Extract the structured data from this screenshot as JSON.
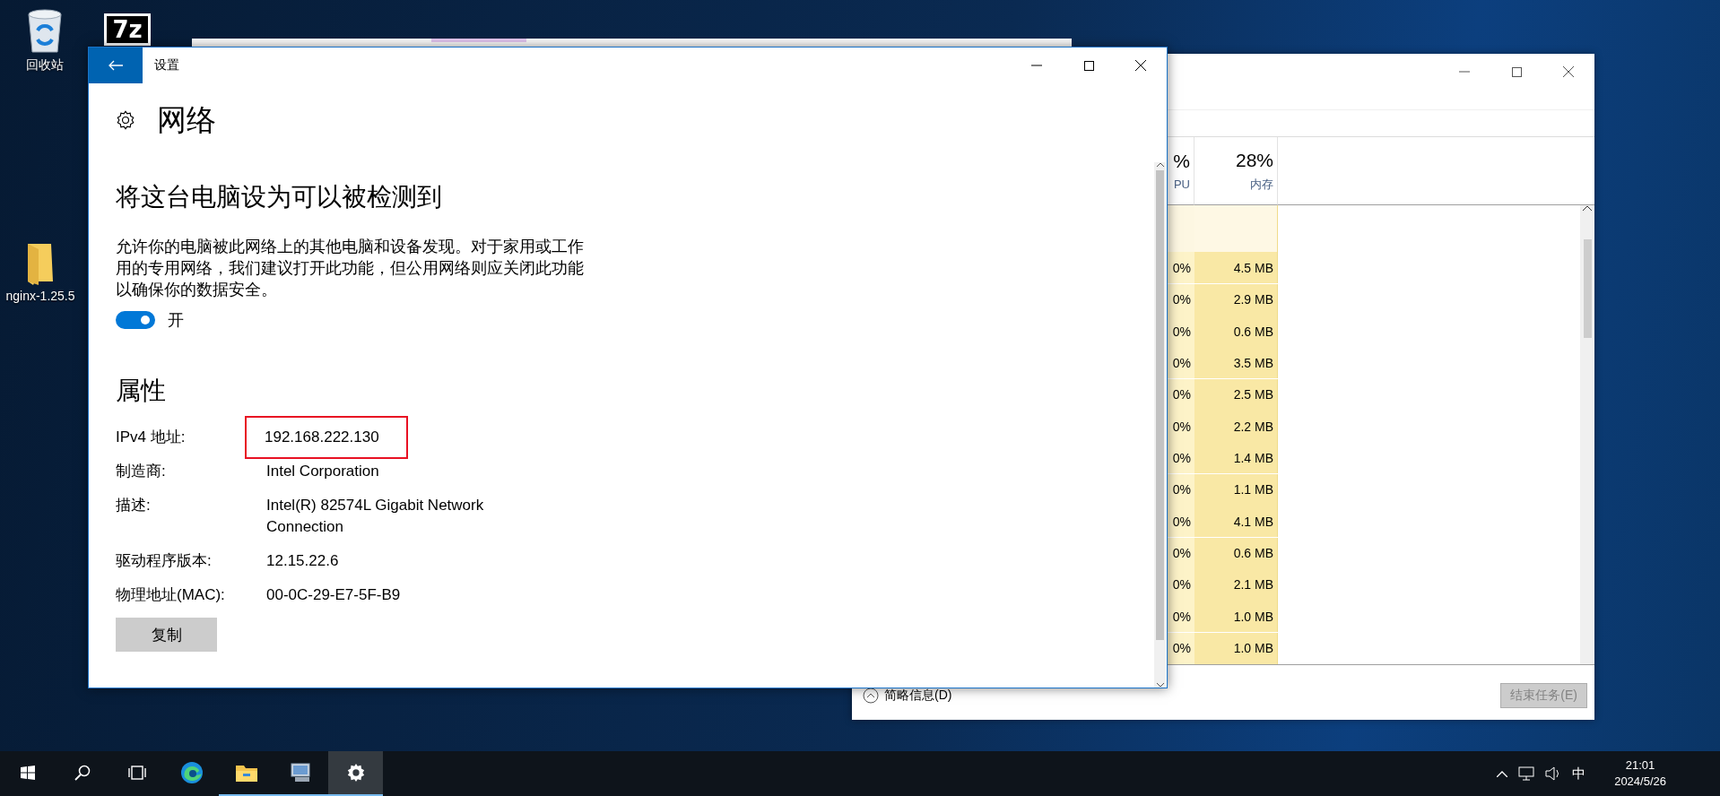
{
  "desktop": {
    "icons": [
      {
        "kind": "recycle-bin",
        "label": "回收站"
      },
      {
        "kind": "archive",
        "badge": "7z"
      },
      {
        "kind": "folder",
        "label": "nginx-1.25.5"
      }
    ]
  },
  "task_manager": {
    "columns": [
      {
        "value": "%",
        "label": "PU"
      },
      {
        "value": "28%",
        "label": "内存"
      }
    ],
    "rows": [
      {
        "cpu": "0%",
        "memory": "4.5 MB"
      },
      {
        "cpu": "0%",
        "memory": "2.9 MB"
      },
      {
        "cpu": "0%",
        "memory": "0.6 MB"
      },
      {
        "cpu": "0%",
        "memory": "3.5 MB"
      },
      {
        "cpu": "0%",
        "memory": "2.5 MB"
      },
      {
        "cpu": "0%",
        "memory": "2.2 MB"
      },
      {
        "cpu": "0%",
        "memory": "1.4 MB"
      },
      {
        "cpu": "0%",
        "memory": "1.1 MB"
      },
      {
        "cpu": "0%",
        "memory": "4.1 MB"
      },
      {
        "cpu": "0%",
        "memory": "0.6 MB"
      },
      {
        "cpu": "0%",
        "memory": "2.1 MB"
      },
      {
        "cpu": "0%",
        "memory": "1.0 MB"
      },
      {
        "cpu": "0%",
        "memory": "1.0 MB"
      }
    ],
    "footer": {
      "details": "简略信息(D)",
      "end_task": {
        "label": "结束任务(E)",
        "disabled": true
      }
    }
  },
  "settings": {
    "window": {
      "title": "设置"
    },
    "page_title": "网络",
    "discovery": {
      "title": "将这台电脑设为可以被检测到",
      "description": "允许你的电脑被此网络上的其他电脑和设备发现。对于家用或工作用的专用网络，我们建议打开此功能，但公用网络则应关闭此功能以确保你的数据安全。",
      "toggle": {
        "on": true,
        "label": "开"
      }
    },
    "properties": {
      "title": "属性",
      "items": [
        {
          "label": "IPv4 地址:",
          "value": "192.168.222.130",
          "highlighted": true
        },
        {
          "label": "制造商:",
          "value": "Intel Corporation",
          "highlighted": false
        },
        {
          "label": "描述:",
          "value": "Intel(R) 82574L Gigabit Network Connection",
          "highlighted": false
        },
        {
          "label": "驱动程序版本:",
          "value": "12.15.22.6",
          "highlighted": false
        },
        {
          "label": "物理地址(MAC):",
          "value": "00-0C-29-E7-5F-B9",
          "highlighted": false
        }
      ],
      "copy_button": "复制"
    }
  },
  "taskbar": {
    "apps": [
      {
        "kind": "start",
        "running": false,
        "selected": false
      },
      {
        "kind": "search",
        "running": false,
        "selected": false
      },
      {
        "kind": "task-view",
        "running": false,
        "selected": false
      },
      {
        "kind": "browser",
        "running": false,
        "selected": false
      },
      {
        "kind": "explorer",
        "running": true,
        "selected": false
      },
      {
        "kind": "computer",
        "running": true,
        "selected": false
      },
      {
        "kind": "settings",
        "running": true,
        "selected": true
      }
    ],
    "tray": {
      "input": "中",
      "time": "21:01",
      "date": "2024/5/26"
    }
  }
}
